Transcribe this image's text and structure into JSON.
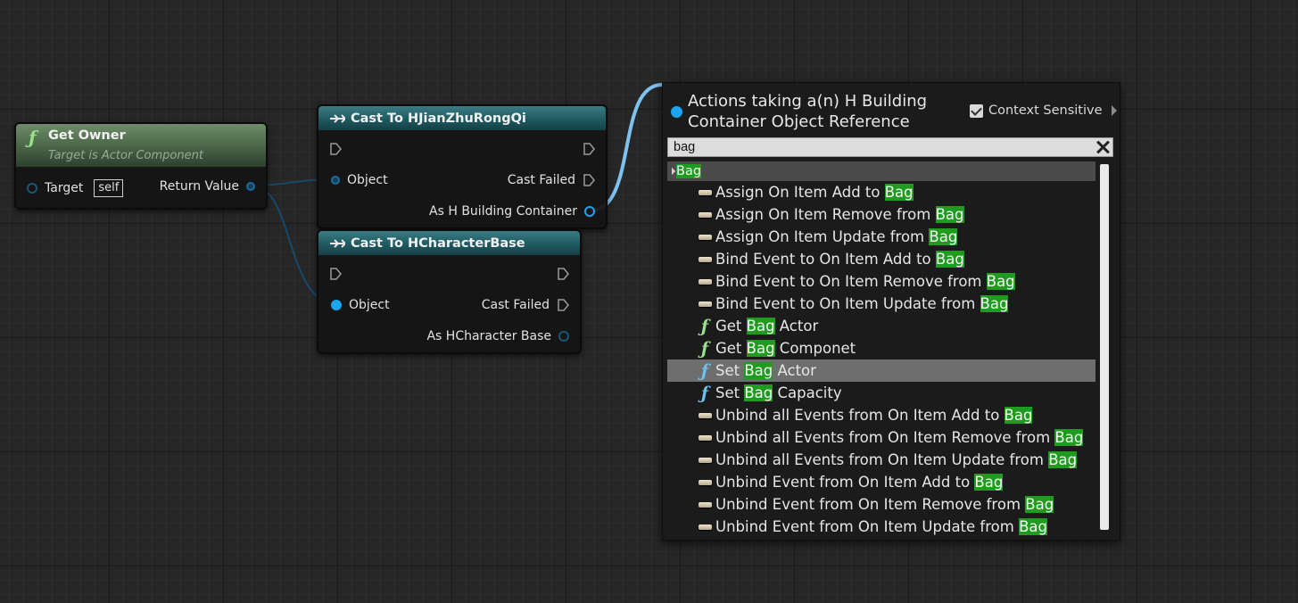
{
  "nodes": {
    "get_owner": {
      "title": "Get Owner",
      "subtitle": "Target is Actor Component",
      "target_label": "Target",
      "self_label": "self",
      "return_label": "Return Value"
    },
    "cast_jianzhu": {
      "title": "Cast To HJianZhuRongQi",
      "object_label": "Object",
      "failed_label": "Cast Failed",
      "as_label": "As H Building Container"
    },
    "cast_character": {
      "title": "Cast To HCharacterBase",
      "object_label": "Object",
      "failed_label": "Cast Failed",
      "as_label": "As HCharacter Base"
    }
  },
  "menu": {
    "title_line1": "Actions taking a(n) H Building",
    "title_line2": "Container Object Reference",
    "context_label": "Context Sensitive",
    "context_checked": true,
    "search_value": "bag",
    "category": "Bag",
    "items": [
      {
        "icon": "event",
        "pre": "Assign On Item Add to ",
        "hl": "Bag",
        "post": ""
      },
      {
        "icon": "event",
        "pre": "Assign On Item Remove from ",
        "hl": "Bag",
        "post": ""
      },
      {
        "icon": "event",
        "pre": "Assign On Item Update from ",
        "hl": "Bag",
        "post": ""
      },
      {
        "icon": "event",
        "pre": "Bind Event to On Item Add to ",
        "hl": "Bag",
        "post": ""
      },
      {
        "icon": "event",
        "pre": "Bind Event to On Item Remove from ",
        "hl": "Bag",
        "post": ""
      },
      {
        "icon": "event",
        "pre": "Bind Event to On Item Update from ",
        "hl": "Bag",
        "post": ""
      },
      {
        "icon": "func-green",
        "pre": "Get ",
        "hl": "Bag",
        "post": " Actor"
      },
      {
        "icon": "func-green",
        "pre": "Get ",
        "hl": "Bag",
        "post": " Componet"
      },
      {
        "icon": "func-blue",
        "pre": "Set ",
        "hl": "Bag",
        "post": " Actor"
      },
      {
        "icon": "func-blue",
        "pre": "Set ",
        "hl": "Bag",
        "post": " Capacity"
      },
      {
        "icon": "event",
        "pre": "Unbind all Events from On Item Add to ",
        "hl": "Bag",
        "post": ""
      },
      {
        "icon": "event",
        "pre": "Unbind all Events from On Item Remove from ",
        "hl": "Bag",
        "post": ""
      },
      {
        "icon": "event",
        "pre": "Unbind all Events from On Item Update from ",
        "hl": "Bag",
        "post": ""
      },
      {
        "icon": "event",
        "pre": "Unbind Event from On Item Add to ",
        "hl": "Bag",
        "post": ""
      },
      {
        "icon": "event",
        "pre": "Unbind Event from On Item Remove from ",
        "hl": "Bag",
        "post": ""
      },
      {
        "icon": "event",
        "pre": "Unbind Event from On Item Update from ",
        "hl": "Bag",
        "post": ""
      }
    ],
    "selected_index": 8
  },
  "colors": {
    "pin_blue": "#1ba4f0",
    "highlight_green": "#1f9c1f",
    "cast_header": "#1f5a62",
    "func_header": "#4e6b4b"
  }
}
